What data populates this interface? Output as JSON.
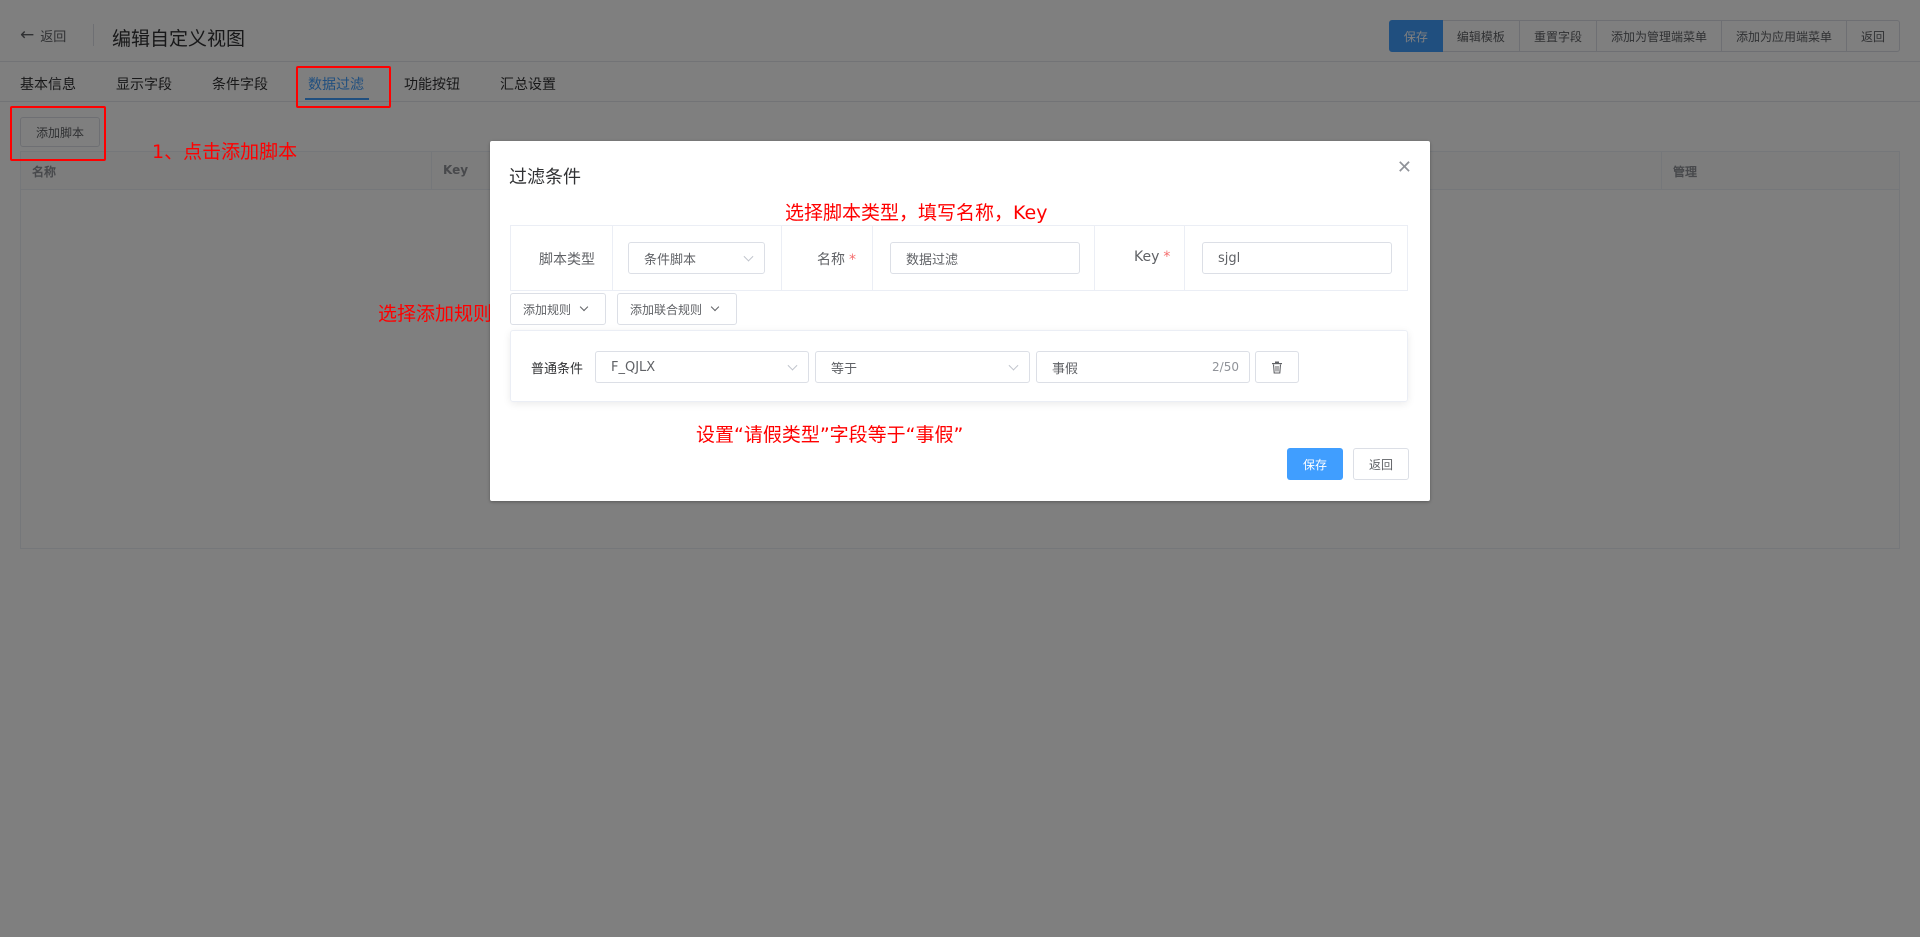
{
  "header": {
    "back_label": "返回",
    "title": "编辑自定义视图",
    "actions": [
      "保存",
      "编辑模板",
      "重置字段",
      "添加为管理端菜单",
      "添加为应用端菜单",
      "返回"
    ]
  },
  "tabs": [
    "基本信息",
    "显示字段",
    "条件字段",
    "数据过滤",
    "功能按钮",
    "汇总设置"
  ],
  "active_tab": "数据过滤",
  "toolbar": {
    "add_script_label": "添加脚本"
  },
  "table": {
    "columns": [
      "名称",
      "Key",
      "管理"
    ]
  },
  "dialog": {
    "title": "过滤条件",
    "script_type_label": "脚本类型",
    "script_type_value": "条件脚本",
    "name_label": "名称",
    "name_value": "数据过滤",
    "key_label": "Key",
    "key_value": "sjgl",
    "add_rule_label": "添加规则",
    "add_joint_rule_label": "添加联合规则",
    "rule": {
      "label": "普通条件",
      "field": "F_QJLX",
      "operator": "等于",
      "value": "事假",
      "counter": "2/50"
    },
    "save_label": "保存",
    "return_label": "返回"
  },
  "annotations": {
    "step1": "1、点击添加脚本",
    "step2": "选择脚本类型，填写名称，Key",
    "step3": "选择添加规则",
    "step4": "设置“请假类型”字段等于“事假”"
  },
  "colors": {
    "primary": "#409eff",
    "annotation": "#ff0000",
    "required": "#f56c6c"
  },
  "icons": [
    "arrow-left-icon",
    "close-icon",
    "chevron-down-icon",
    "trash-icon"
  ]
}
